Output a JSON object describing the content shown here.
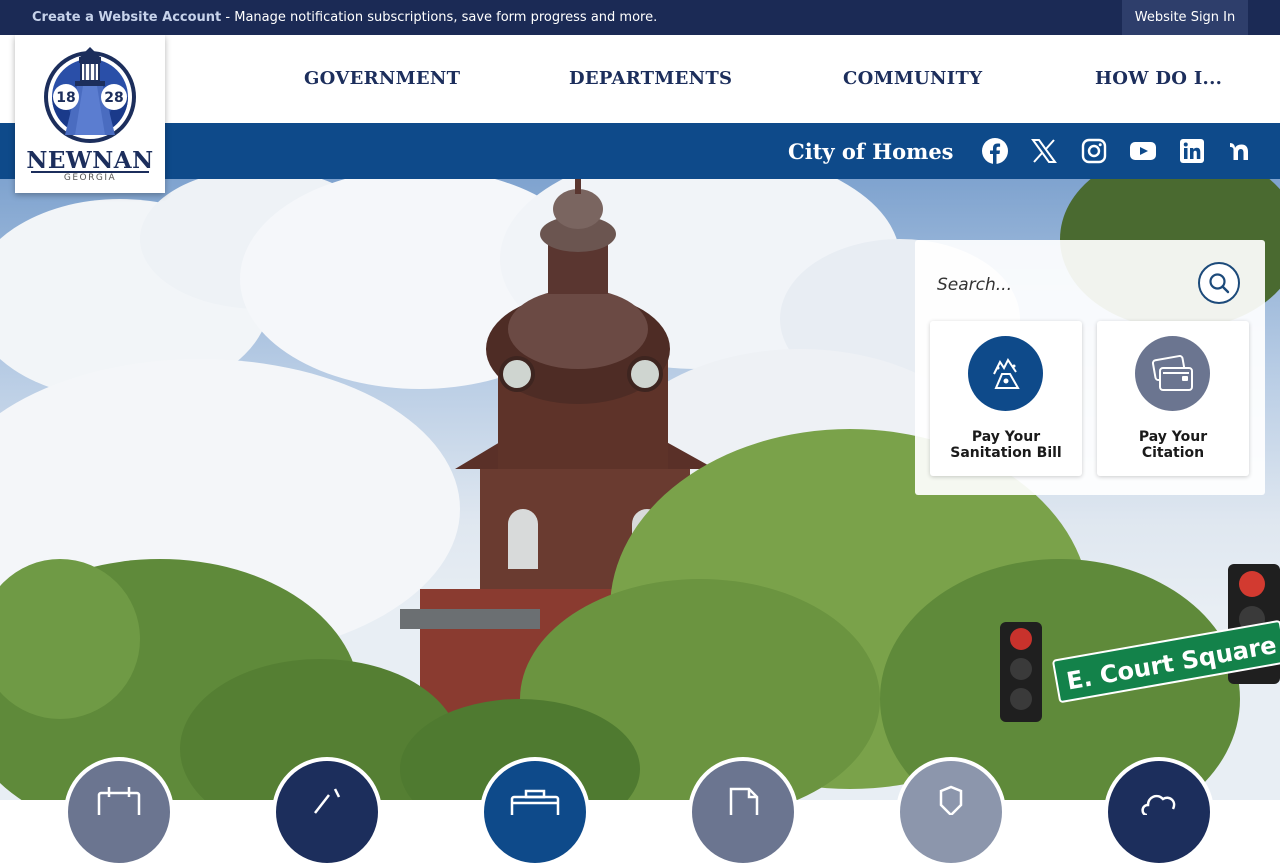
{
  "topbar": {
    "create_account": "Create a Website Account",
    "message": " - Manage notification subscriptions, save form progress and more.",
    "signin": "Website Sign In"
  },
  "logo": {
    "year_left": "18",
    "year_right": "28",
    "name": "NEWNAN",
    "state": "GEORGIA"
  },
  "nav": {
    "items": [
      {
        "label": "GOVERNMENT"
      },
      {
        "label": "DEPARTMENTS"
      },
      {
        "label": "COMMUNITY"
      },
      {
        "label": "HOW DO I..."
      }
    ]
  },
  "band": {
    "tagline": "City of Homes",
    "social": [
      "facebook-icon",
      "x-twitter-icon",
      "instagram-icon",
      "youtube-icon",
      "linkedin-icon",
      "nextdoor-icon"
    ]
  },
  "hero": {
    "sign_text": "E. Court Square"
  },
  "search": {
    "placeholder": "Search..."
  },
  "tiles": [
    {
      "label_line1": "Pay Your",
      "label_line2": "Sanitation Bill",
      "color": "#0e4a8a"
    },
    {
      "label_line1": "Pay Your",
      "label_line2": "Citation",
      "color": "#6b7590"
    }
  ],
  "colors": {
    "navy": "#1b2a55",
    "brand_blue": "#0e4a8a",
    "nav_text": "#1c2e5c"
  }
}
